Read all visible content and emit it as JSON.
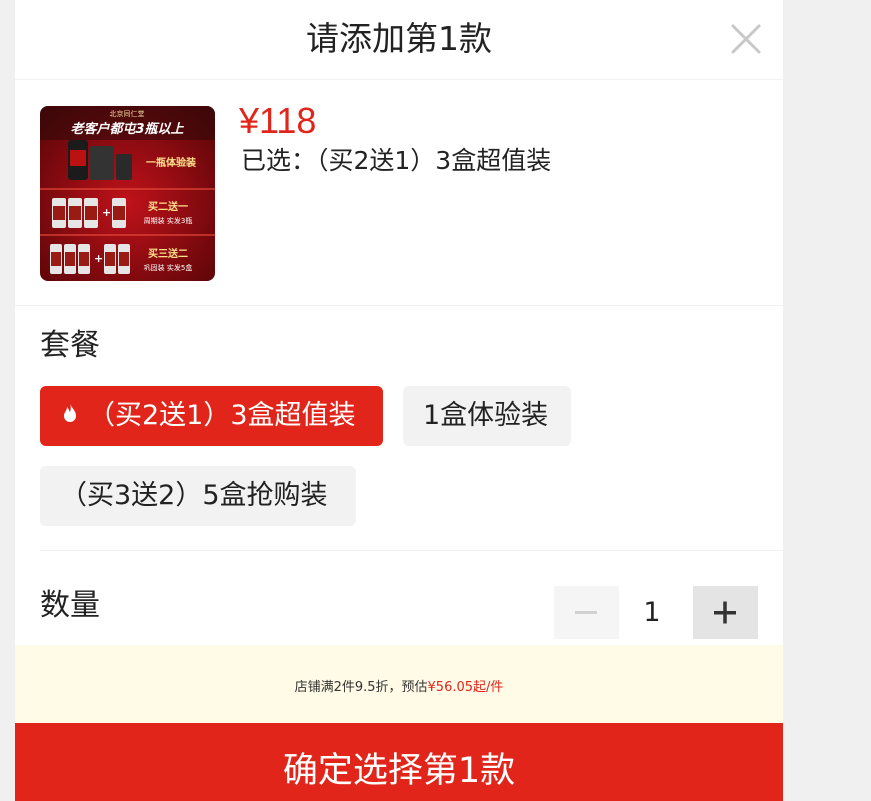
{
  "header": {
    "title": "请添加第1款"
  },
  "product": {
    "price": "¥118",
    "selected_text": "已选：（买2送1）3盒超值装",
    "thumbnail": {
      "brand": "北京同仁堂",
      "headline": "老客户都屯3瓶以上",
      "row1": "一瓶体验装",
      "row2_title": "买二送一",
      "row2_sub": "周期装 实发3瓶",
      "row3_title": "买三送二",
      "row3_sub": "巩固装 实发5盒"
    }
  },
  "package": {
    "label": "套餐",
    "options": [
      {
        "label": "（买2送1）3盒超值装",
        "active": true,
        "icon": "fire-icon"
      },
      {
        "label": "1盒体验装",
        "active": false
      },
      {
        "label": "（买3送2）5盒抢购装",
        "active": false
      }
    ]
  },
  "quantity": {
    "label": "数量",
    "value": "1",
    "minus": "−",
    "plus": "+"
  },
  "promo": {
    "prefix": "店铺满2件9.5折，预估",
    "highlight": "¥56.05起/件"
  },
  "confirm": {
    "label": "确定选择第1款"
  },
  "colors": {
    "accent": "#e1251b",
    "promo_bg": "#fffbe6",
    "chip_bg": "#f2f2f2"
  }
}
